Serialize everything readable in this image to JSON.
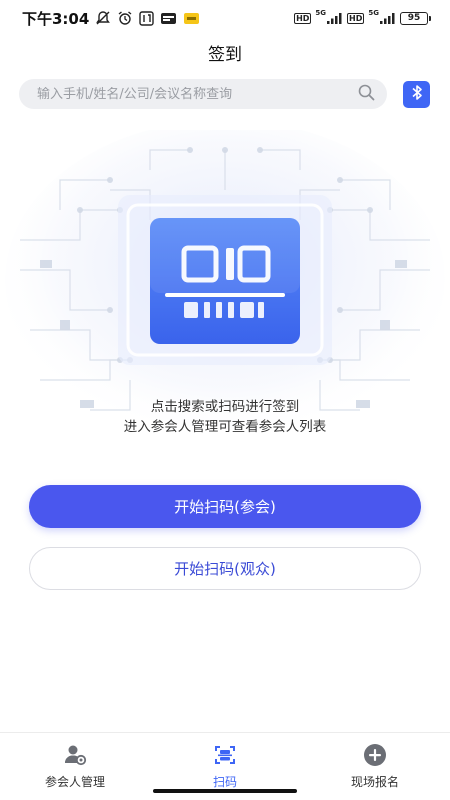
{
  "status_bar": {
    "time": "下午3:04",
    "hd1": "HD",
    "net1": "5G",
    "hd2": "HD",
    "net2": "5G",
    "battery": "95",
    "icons": [
      "mute-icon",
      "alarm-icon",
      "app-notification-icon",
      "app-notification-icon",
      "app-notification-icon"
    ]
  },
  "header": {
    "title": "签到"
  },
  "search": {
    "placeholder": "输入手机/姓名/公司/会议名称查询",
    "value": ""
  },
  "hero": {
    "line1": "点击搜索或扫码进行签到",
    "line2": "进入参会人管理可查看参会人列表"
  },
  "actions": {
    "primary": "开始扫码(参会)",
    "secondary": "开始扫码(观众)"
  },
  "bottom_nav": {
    "items": [
      {
        "label": "参会人管理",
        "icon": "attendee-manage-icon",
        "active": false
      },
      {
        "label": "扫码",
        "icon": "scan-icon",
        "active": true
      },
      {
        "label": "现场报名",
        "icon": "add-circle-icon",
        "active": false
      }
    ]
  },
  "colors": {
    "accent": "#3f66f5",
    "primary_button": "#4a57ee",
    "secondary_text": "#3b4bd6"
  }
}
